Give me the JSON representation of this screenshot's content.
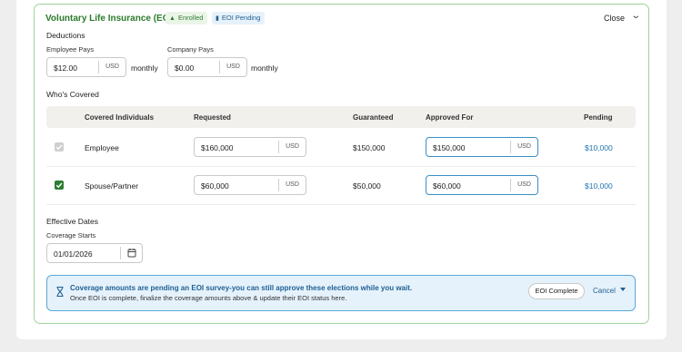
{
  "header": {
    "title": "Voluntary Life Insurance (EOI)",
    "badges": {
      "enrolled": "Enrolled",
      "eoi_pending": "EOI Pending"
    },
    "close_label": "Close"
  },
  "deductions": {
    "section_label": "Deductions",
    "employee": {
      "label": "Employee Pays",
      "value": "$12.00",
      "unit": "USD",
      "period": "monthly"
    },
    "company": {
      "label": "Company Pays",
      "value": "$0.00",
      "unit": "USD",
      "period": "monthly"
    }
  },
  "covered": {
    "section_label": "Who's Covered",
    "columns": [
      "Covered Individuals",
      "Requested",
      "Guaranteed",
      "Approved For",
      "Pending"
    ],
    "rows": [
      {
        "name": "Employee",
        "checked": true,
        "disabled": true,
        "requested": "$160,000",
        "requested_unit": "USD",
        "guaranteed": "$150,000",
        "approved": "$150,000",
        "approved_unit": "USD",
        "pending": "$10,000"
      },
      {
        "name": "Spouse/Partner",
        "checked": true,
        "disabled": false,
        "requested": "$60,000",
        "requested_unit": "USD",
        "guaranteed": "$50,000",
        "approved": "$60,000",
        "approved_unit": "USD",
        "pending": "$10,000"
      }
    ]
  },
  "effective": {
    "section_label": "Effective Dates",
    "coverage_label": "Coverage Starts",
    "coverage_value": "01/01/2026"
  },
  "alert": {
    "title": "Coverage amounts are pending an EOI survey-you can still approve these elections while you wait.",
    "body": "Once EOI is complete, finalize the coverage amounts above & update their EOI status here.",
    "eoi_button": "EOI Complete",
    "cancel_label": "Cancel"
  },
  "colors": {
    "accent_green": "#2e7d32",
    "card_border": "#9fd29a",
    "link_blue": "#1f74b0",
    "alert_bg": "#e5f2fb"
  }
}
